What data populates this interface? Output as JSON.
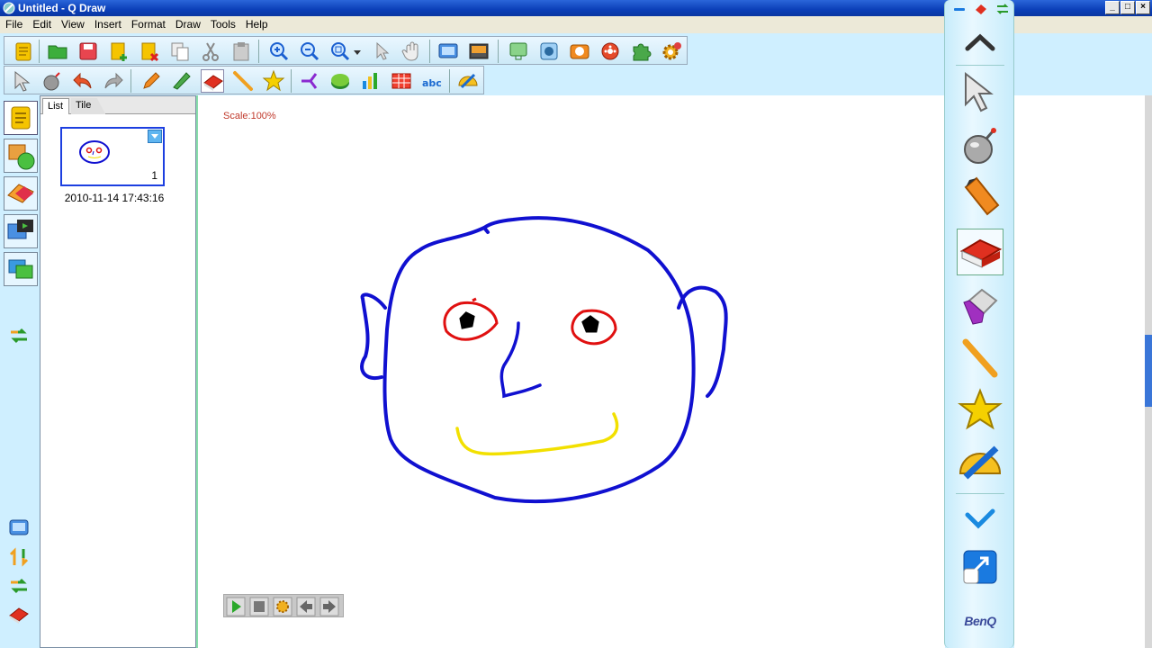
{
  "window": {
    "title": "Untitled - Q Draw"
  },
  "menu": [
    "File",
    "Edit",
    "View",
    "Insert",
    "Format",
    "Draw",
    "Tools",
    "Help"
  ],
  "toolbar1_icons": [
    "new-page-icon",
    "open-file-icon",
    "save-icon",
    "add-page-icon",
    "delete-page-icon",
    "copy-icon",
    "cut-icon",
    "paste-icon",
    "zoom-in-icon",
    "zoom-out-icon",
    "zoom-fit-icon",
    "zoom-dropdown-icon",
    "pointer-pan-icon",
    "hand-icon",
    "fullscreen-icon",
    "screen-capture-icon",
    "record-icon",
    "camera-sphere-icon",
    "snapshot-icon",
    "film-icon",
    "puzzle-icon",
    "settings-gear-icon"
  ],
  "toolbar2_icons": [
    "select-arrow-icon",
    "clear-bomb-icon",
    "undo-icon",
    "redo-icon",
    "pen-icon",
    "marker-icon",
    "eraser-icon",
    "line-icon",
    "star-shape-icon",
    "connector-icon",
    "pie-chart-icon",
    "bar-chart-icon",
    "table-icon",
    "text-abc-icon",
    "protractor-icon"
  ],
  "panel": {
    "tabs": [
      "List",
      "Tile"
    ],
    "page_number": "1",
    "page_date": "2010-11-14 17:43:16"
  },
  "canvas": {
    "scale_label": "Scale:100%"
  },
  "floating_toolbar": {
    "tools": [
      "collapse-up-icon",
      "select-arrow-icon",
      "clear-bomb-icon",
      "pen-icon",
      "eraser-icon",
      "magic-eraser-icon",
      "line-icon",
      "star-shape-icon",
      "protractor-icon",
      "confirm-check-icon",
      "exit-share-icon"
    ],
    "active_tool": "eraser-icon",
    "brand": "BenQ"
  },
  "colors": {
    "face": "#1010d0",
    "eyes": "#e01010",
    "pupils": "#000000",
    "mouth": "#f2e000",
    "accent": "#0b3fb8"
  }
}
